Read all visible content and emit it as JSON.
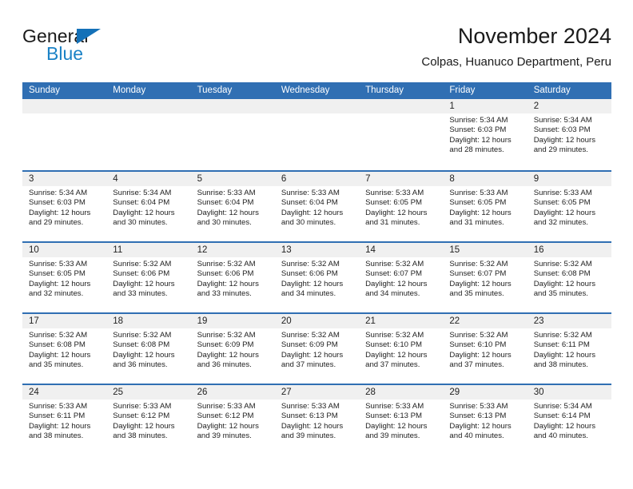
{
  "brand": {
    "name_top": "General",
    "name_bottom": "Blue",
    "accent_color": "#1471b8",
    "text_color": "#1b82c6"
  },
  "header": {
    "title": "November 2024",
    "subtitle": "Colpas, Huanuco Department, Peru"
  },
  "theme": {
    "header_blue": "#306fb3",
    "day_band_gray": "#f0f0f0",
    "text": "#222222"
  },
  "weekdays": [
    "Sunday",
    "Monday",
    "Tuesday",
    "Wednesday",
    "Thursday",
    "Friday",
    "Saturday"
  ],
  "weeks": [
    [
      {
        "day": "",
        "sunrise": "",
        "sunset": "",
        "daylight_1": "",
        "daylight_2": ""
      },
      {
        "day": "",
        "sunrise": "",
        "sunset": "",
        "daylight_1": "",
        "daylight_2": ""
      },
      {
        "day": "",
        "sunrise": "",
        "sunset": "",
        "daylight_1": "",
        "daylight_2": ""
      },
      {
        "day": "",
        "sunrise": "",
        "sunset": "",
        "daylight_1": "",
        "daylight_2": ""
      },
      {
        "day": "",
        "sunrise": "",
        "sunset": "",
        "daylight_1": "",
        "daylight_2": ""
      },
      {
        "day": "1",
        "sunrise": "Sunrise: 5:34 AM",
        "sunset": "Sunset: 6:03 PM",
        "daylight_1": "Daylight: 12 hours",
        "daylight_2": "and 28 minutes."
      },
      {
        "day": "2",
        "sunrise": "Sunrise: 5:34 AM",
        "sunset": "Sunset: 6:03 PM",
        "daylight_1": "Daylight: 12 hours",
        "daylight_2": "and 29 minutes."
      }
    ],
    [
      {
        "day": "3",
        "sunrise": "Sunrise: 5:34 AM",
        "sunset": "Sunset: 6:03 PM",
        "daylight_1": "Daylight: 12 hours",
        "daylight_2": "and 29 minutes."
      },
      {
        "day": "4",
        "sunrise": "Sunrise: 5:34 AM",
        "sunset": "Sunset: 6:04 PM",
        "daylight_1": "Daylight: 12 hours",
        "daylight_2": "and 30 minutes."
      },
      {
        "day": "5",
        "sunrise": "Sunrise: 5:33 AM",
        "sunset": "Sunset: 6:04 PM",
        "daylight_1": "Daylight: 12 hours",
        "daylight_2": "and 30 minutes."
      },
      {
        "day": "6",
        "sunrise": "Sunrise: 5:33 AM",
        "sunset": "Sunset: 6:04 PM",
        "daylight_1": "Daylight: 12 hours",
        "daylight_2": "and 30 minutes."
      },
      {
        "day": "7",
        "sunrise": "Sunrise: 5:33 AM",
        "sunset": "Sunset: 6:05 PM",
        "daylight_1": "Daylight: 12 hours",
        "daylight_2": "and 31 minutes."
      },
      {
        "day": "8",
        "sunrise": "Sunrise: 5:33 AM",
        "sunset": "Sunset: 6:05 PM",
        "daylight_1": "Daylight: 12 hours",
        "daylight_2": "and 31 minutes."
      },
      {
        "day": "9",
        "sunrise": "Sunrise: 5:33 AM",
        "sunset": "Sunset: 6:05 PM",
        "daylight_1": "Daylight: 12 hours",
        "daylight_2": "and 32 minutes."
      }
    ],
    [
      {
        "day": "10",
        "sunrise": "Sunrise: 5:33 AM",
        "sunset": "Sunset: 6:05 PM",
        "daylight_1": "Daylight: 12 hours",
        "daylight_2": "and 32 minutes."
      },
      {
        "day": "11",
        "sunrise": "Sunrise: 5:32 AM",
        "sunset": "Sunset: 6:06 PM",
        "daylight_1": "Daylight: 12 hours",
        "daylight_2": "and 33 minutes."
      },
      {
        "day": "12",
        "sunrise": "Sunrise: 5:32 AM",
        "sunset": "Sunset: 6:06 PM",
        "daylight_1": "Daylight: 12 hours",
        "daylight_2": "and 33 minutes."
      },
      {
        "day": "13",
        "sunrise": "Sunrise: 5:32 AM",
        "sunset": "Sunset: 6:06 PM",
        "daylight_1": "Daylight: 12 hours",
        "daylight_2": "and 34 minutes."
      },
      {
        "day": "14",
        "sunrise": "Sunrise: 5:32 AM",
        "sunset": "Sunset: 6:07 PM",
        "daylight_1": "Daylight: 12 hours",
        "daylight_2": "and 34 minutes."
      },
      {
        "day": "15",
        "sunrise": "Sunrise: 5:32 AM",
        "sunset": "Sunset: 6:07 PM",
        "daylight_1": "Daylight: 12 hours",
        "daylight_2": "and 35 minutes."
      },
      {
        "day": "16",
        "sunrise": "Sunrise: 5:32 AM",
        "sunset": "Sunset: 6:08 PM",
        "daylight_1": "Daylight: 12 hours",
        "daylight_2": "and 35 minutes."
      }
    ],
    [
      {
        "day": "17",
        "sunrise": "Sunrise: 5:32 AM",
        "sunset": "Sunset: 6:08 PM",
        "daylight_1": "Daylight: 12 hours",
        "daylight_2": "and 35 minutes."
      },
      {
        "day": "18",
        "sunrise": "Sunrise: 5:32 AM",
        "sunset": "Sunset: 6:08 PM",
        "daylight_1": "Daylight: 12 hours",
        "daylight_2": "and 36 minutes."
      },
      {
        "day": "19",
        "sunrise": "Sunrise: 5:32 AM",
        "sunset": "Sunset: 6:09 PM",
        "daylight_1": "Daylight: 12 hours",
        "daylight_2": "and 36 minutes."
      },
      {
        "day": "20",
        "sunrise": "Sunrise: 5:32 AM",
        "sunset": "Sunset: 6:09 PM",
        "daylight_1": "Daylight: 12 hours",
        "daylight_2": "and 37 minutes."
      },
      {
        "day": "21",
        "sunrise": "Sunrise: 5:32 AM",
        "sunset": "Sunset: 6:10 PM",
        "daylight_1": "Daylight: 12 hours",
        "daylight_2": "and 37 minutes."
      },
      {
        "day": "22",
        "sunrise": "Sunrise: 5:32 AM",
        "sunset": "Sunset: 6:10 PM",
        "daylight_1": "Daylight: 12 hours",
        "daylight_2": "and 37 minutes."
      },
      {
        "day": "23",
        "sunrise": "Sunrise: 5:32 AM",
        "sunset": "Sunset: 6:11 PM",
        "daylight_1": "Daylight: 12 hours",
        "daylight_2": "and 38 minutes."
      }
    ],
    [
      {
        "day": "24",
        "sunrise": "Sunrise: 5:33 AM",
        "sunset": "Sunset: 6:11 PM",
        "daylight_1": "Daylight: 12 hours",
        "daylight_2": "and 38 minutes."
      },
      {
        "day": "25",
        "sunrise": "Sunrise: 5:33 AM",
        "sunset": "Sunset: 6:12 PM",
        "daylight_1": "Daylight: 12 hours",
        "daylight_2": "and 38 minutes."
      },
      {
        "day": "26",
        "sunrise": "Sunrise: 5:33 AM",
        "sunset": "Sunset: 6:12 PM",
        "daylight_1": "Daylight: 12 hours",
        "daylight_2": "and 39 minutes."
      },
      {
        "day": "27",
        "sunrise": "Sunrise: 5:33 AM",
        "sunset": "Sunset: 6:13 PM",
        "daylight_1": "Daylight: 12 hours",
        "daylight_2": "and 39 minutes."
      },
      {
        "day": "28",
        "sunrise": "Sunrise: 5:33 AM",
        "sunset": "Sunset: 6:13 PM",
        "daylight_1": "Daylight: 12 hours",
        "daylight_2": "and 39 minutes."
      },
      {
        "day": "29",
        "sunrise": "Sunrise: 5:33 AM",
        "sunset": "Sunset: 6:13 PM",
        "daylight_1": "Daylight: 12 hours",
        "daylight_2": "and 40 minutes."
      },
      {
        "day": "30",
        "sunrise": "Sunrise: 5:34 AM",
        "sunset": "Sunset: 6:14 PM",
        "daylight_1": "Daylight: 12 hours",
        "daylight_2": "and 40 minutes."
      }
    ]
  ]
}
